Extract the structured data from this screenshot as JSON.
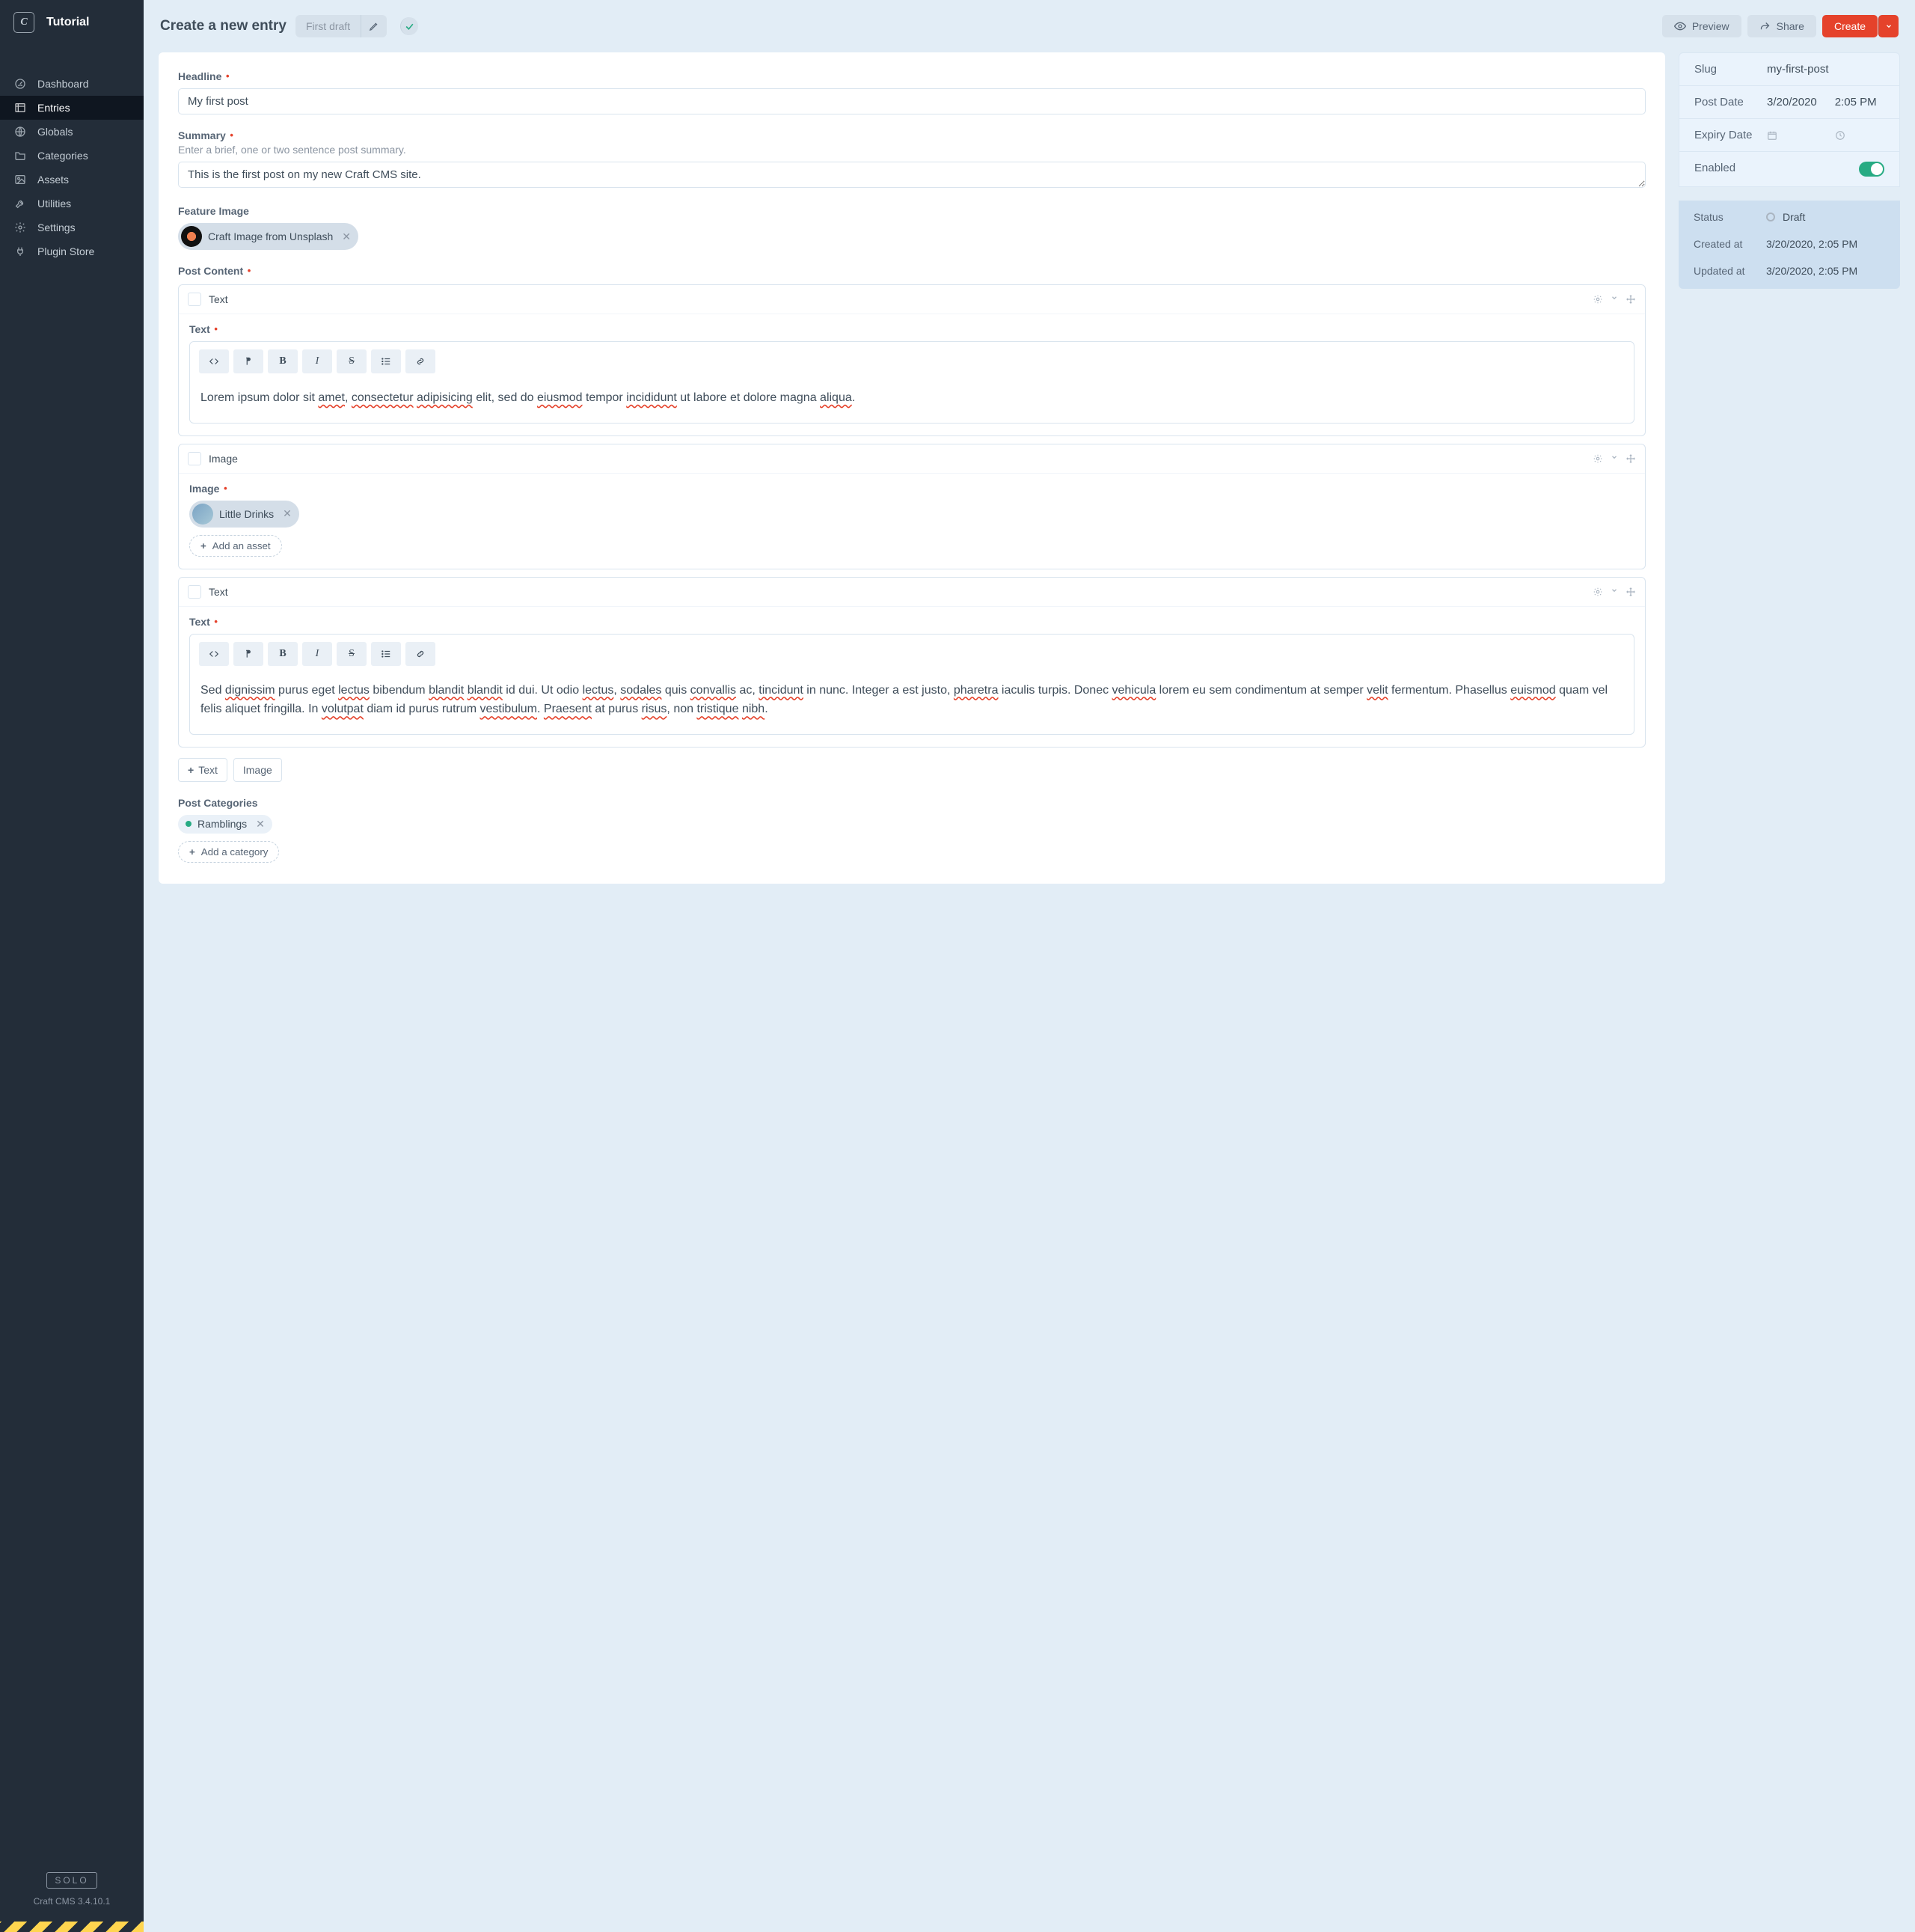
{
  "sidebar": {
    "title": "Tutorial",
    "items": [
      {
        "icon": "dashboard-icon",
        "label": "Dashboard"
      },
      {
        "icon": "entries-icon",
        "label": "Entries",
        "active": true
      },
      {
        "icon": "globe-icon",
        "label": "Globals"
      },
      {
        "icon": "folder-icon",
        "label": "Categories"
      },
      {
        "icon": "image-icon",
        "label": "Assets"
      },
      {
        "icon": "wrench-icon",
        "label": "Utilities"
      },
      {
        "icon": "gear-icon",
        "label": "Settings"
      },
      {
        "icon": "plug-icon",
        "label": "Plugin Store"
      }
    ],
    "edition": "SOLO",
    "version": "Craft CMS 3.4.10.1"
  },
  "header": {
    "title": "Create a new entry",
    "revision": "First draft",
    "preview": "Preview",
    "share": "Share",
    "create": "Create"
  },
  "entry": {
    "headline_label": "Headline",
    "headline_value": "My first post",
    "summary_label": "Summary",
    "summary_help": "Enter a brief, one or two sentence post summary.",
    "summary_value": "This is the first post on my new Craft CMS site.",
    "feature_image_label": "Feature Image",
    "feature_image_chip": "Craft Image from Unsplash",
    "post_content_label": "Post Content",
    "blocks": [
      {
        "type": "Text",
        "field_label": "Text",
        "body_html": "Lorem ipsum dolor sit <span class='sq-red'>amet</span>, <span class='sq-red'>consectetur</span> <span class='sq-red'>adipisicing</span> elit, sed do <span class='sq-red'>eiusmod</span> tempor <span class='sq-red'>incididunt</span> ut labore et dolore magna <span class='sq-red'>aliqua</span>."
      },
      {
        "type": "Image",
        "field_label": "Image",
        "asset": "Little Drinks",
        "add": "Add an asset"
      },
      {
        "type": "Text",
        "field_label": "Text",
        "body_html": "Sed <span class='sq-red'>dignissim</span> purus eget <span class='sq-red'>lectus</span> bibendum <span class='sq-red'>blandit</span> <span class='sq-red'>blandit</span> id dui. Ut odio <span class='sq-red'>lectus</span>, <span class='sq-red'>sodales</span> quis <span class='sq-red'>convallis</span> ac, <span class='sq-red'>tincidunt</span> in nunc. Integer a est justo, <span class='sq-red'>pharetra</span> iaculis turpis. Donec <span class='sq-red'>vehicula</span> lorem eu sem condimentum at semper <span class='sq-red'>velit</span> fermentum. Phasellus <span class='sq-red'>euismod</span> quam vel felis aliquet fringilla. In <span class='sq-red'>volutpat</span> diam id purus rutrum <span class='sq-red'>vestibulum</span>. <span class='sq-red'>Praesent</span> at purus <span class='sq-red'>risus</span>, non <span class='sq-red'>tristique</span> <span class='sq-red'>nibh</span>."
      }
    ],
    "add_text": "Text",
    "add_image": "Image",
    "categories_label": "Post Categories",
    "category": "Ramblings",
    "add_category": "Add a category"
  },
  "meta": {
    "slug_label": "Slug",
    "slug": "my-first-post",
    "post_date_label": "Post Date",
    "post_date": "3/20/2020",
    "post_time": "2:05 PM",
    "expiry_label": "Expiry Date",
    "enabled_label": "Enabled",
    "status_label": "Status",
    "status": "Draft",
    "created_label": "Created at",
    "created": "3/20/2020, 2:05 PM",
    "updated_label": "Updated at",
    "updated": "3/20/2020, 2:05 PM"
  }
}
